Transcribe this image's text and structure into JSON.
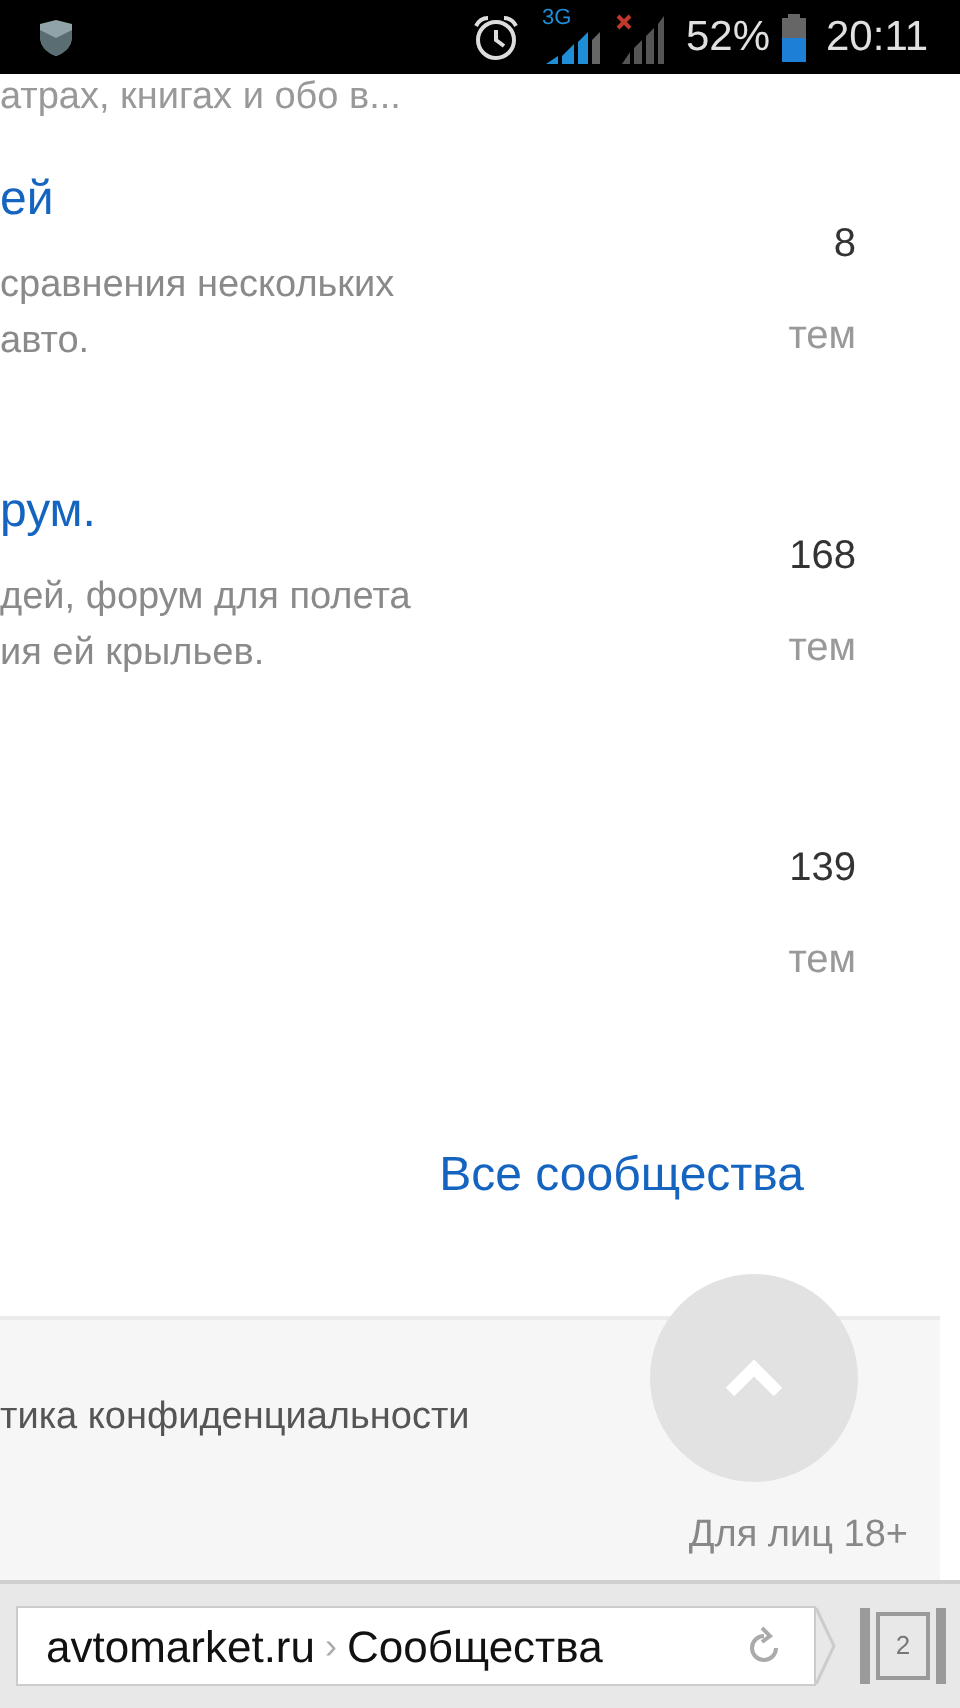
{
  "status_bar": {
    "network": "3G",
    "battery": "52%",
    "time": "20:11"
  },
  "top_text": "атрах, книгах и обо в...",
  "communities": [
    {
      "title": "ей",
      "description_lines": [
        "сравнения нескольких",
        "авто."
      ],
      "count": "8",
      "unit": "тем"
    },
    {
      "title": "рум.",
      "description_lines": [
        "дей, форум для полета",
        "ия ей крыльев."
      ],
      "count": "168",
      "unit": "тем"
    },
    {
      "count": "139",
      "unit": "тем"
    }
  ],
  "all_link": "Все сообщества",
  "footer": {
    "policy_link": "тика конфиденциальности",
    "age_notice": "Для лиц 18+"
  },
  "browser": {
    "domain": "avtomarket.ru",
    "separator": "›",
    "page": "Сообщества",
    "tab_count": "2"
  }
}
